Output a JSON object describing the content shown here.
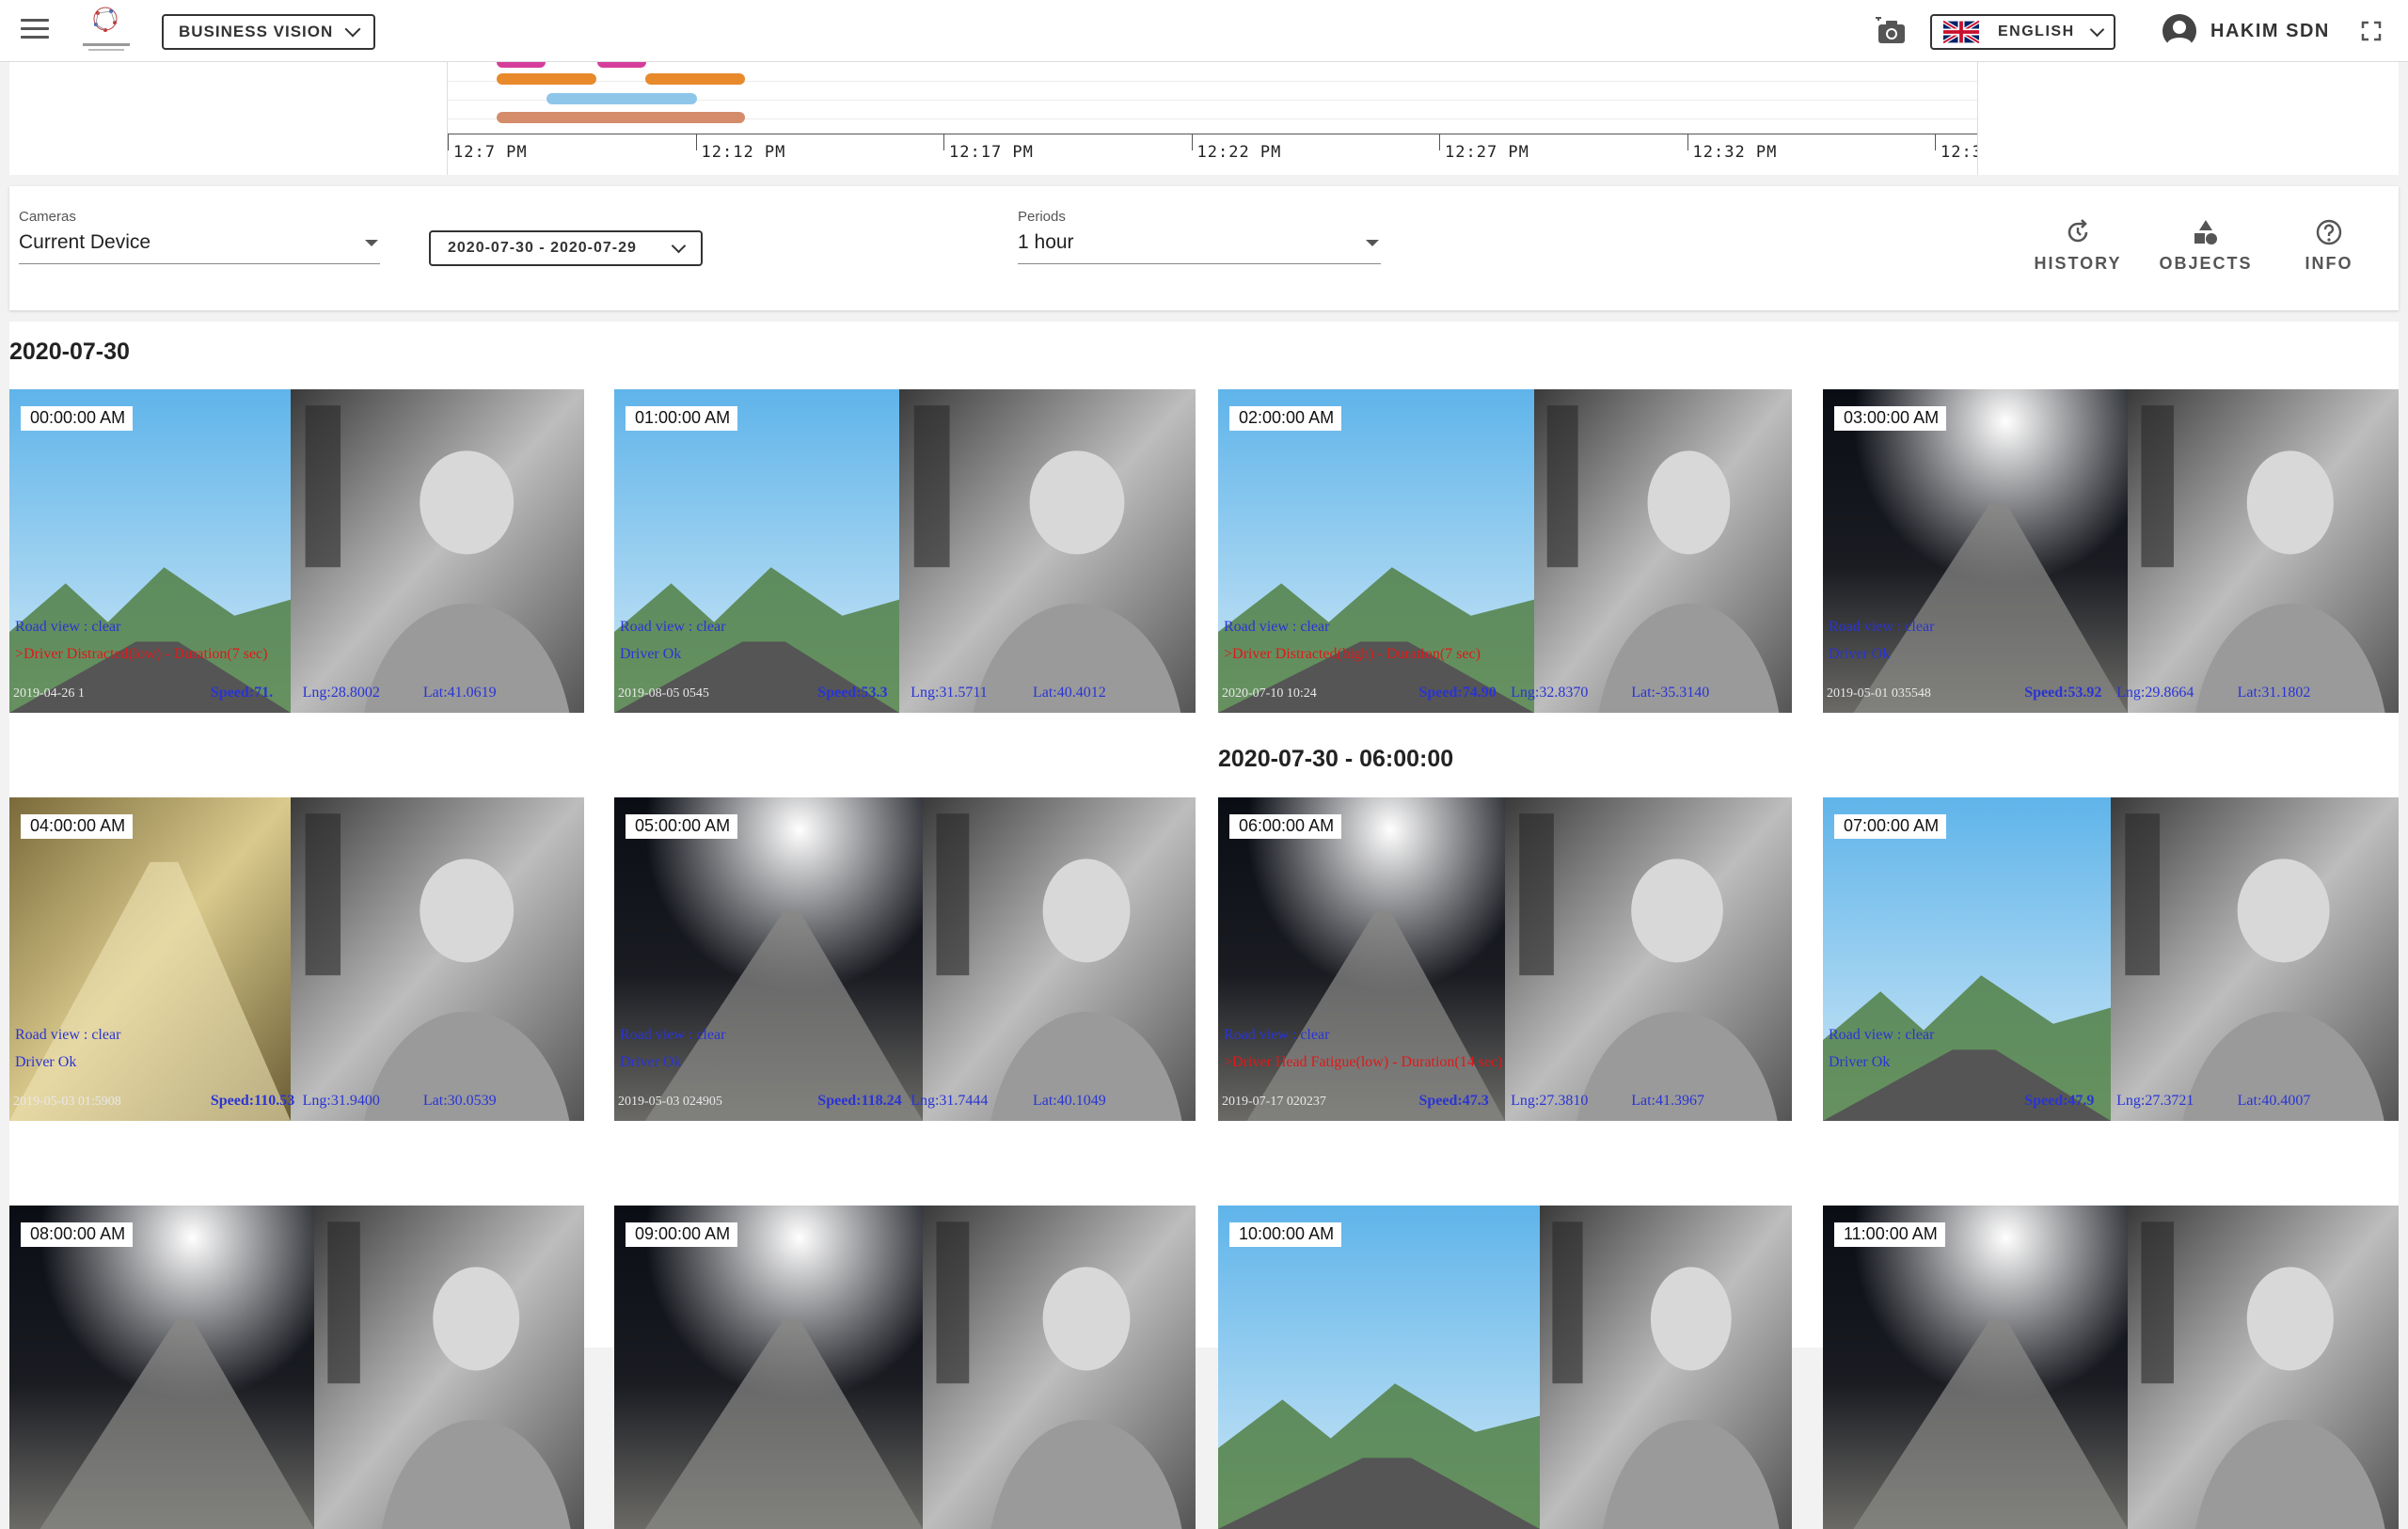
{
  "header": {
    "vision_label": "BUSINESS VISION",
    "language_label": "ENGLISH",
    "user_name": "HAKIM SDN"
  },
  "timeline": {
    "labels": [
      "12:7 PM",
      "12:12 PM",
      "12:17 PM",
      "12:22 PM",
      "12:27 PM",
      "12:32 PM",
      "12:3"
    ]
  },
  "filters": {
    "cameras_label": "Cameras",
    "cameras_value": "Current Device",
    "date_range": "2020-07-30 - 2020-07-29",
    "periods_label": "Periods",
    "periods_value": "1 hour",
    "actions": {
      "history": "HISTORY",
      "objects": "OBJECTS",
      "info": "INFO"
    }
  },
  "groups": [
    {
      "title": "2020-07-30"
    },
    {
      "title": "2020-07-30 - 06:00:00"
    }
  ],
  "thumbnails": [
    {
      "time": "00:00:00 AM",
      "road": "Road view : clear",
      "status": ">Driver Distracted(low) -  Duration(7 sec)",
      "status_color": "red",
      "date": "2019-04-26 1",
      "speed": "Speed:71.",
      "lng": "Lng:28.8002",
      "lat": "Lat:41.0619"
    },
    {
      "time": "01:00:00 AM",
      "road": "Road view : clear",
      "status": "Driver Ok",
      "status_color": "blue",
      "date": "2019-08-05 0545",
      "speed": "Speed:53.3",
      "lng": "Lng:31.5711",
      "lat": "Lat:40.4012"
    },
    {
      "time": "02:00:00 AM",
      "road": "Road view : clear",
      "status": ">Driver Distracted(high) -  Duration(7 sec)",
      "status_color": "red",
      "date": "2020-07-10 10:24",
      "speed": "Speed:74.90",
      "lng": "Lng:32.8370",
      "lat": "Lat:-35.3140"
    },
    {
      "time": "03:00:00 AM",
      "road": "Road view : clear",
      "status": "Driver Ok",
      "status_color": "blue",
      "date": "2019-05-01 035548",
      "speed": "Speed:53.92",
      "lng": "Lng:29.8664",
      "lat": "Lat:31.1802"
    },
    {
      "time": "04:00:00 AM",
      "road": "Road view : clear",
      "status": "Driver Ok",
      "status_color": "blue",
      "date": "2019-05-03 01:5908",
      "speed": "Speed:110.53",
      "lng": "Lng:31.9400",
      "lat": "Lat:30.0539"
    },
    {
      "time": "05:00:00 AM",
      "road": "Road view : clear",
      "status": "Driver Ok",
      "status_color": "blue",
      "date": "2019-05-03 024905",
      "speed": "Speed:118.24",
      "lng": "Lng:31.7444",
      "lat": "Lat:40.1049"
    },
    {
      "time": "06:00:00 AM",
      "road": "Road view : clear",
      "status": ">Driver Head Fatigue(low) -  Duration(14 sec)",
      "status_color": "red",
      "date": "2019-07-17 020237",
      "speed": "Speed:47.3",
      "lng": "Lng:27.3810",
      "lat": "Lat:41.3967"
    },
    {
      "time": "07:00:00 AM",
      "road": "Road view : clear",
      "status": "Driver Ok",
      "status_color": "blue",
      "date": "",
      "speed": "Speed:47.9",
      "lng": "Lng:27.3721",
      "lat": "Lat:40.4007"
    },
    {
      "time": "08:00:00 AM"
    },
    {
      "time": "09:00:00 AM"
    },
    {
      "time": "10:00:00 AM"
    },
    {
      "time": "11:00:00 AM"
    }
  ],
  "colors": {
    "bar_pink": "#d63d9a",
    "bar_orange": "#e8892b",
    "bar_blue": "#8ec6ea",
    "bar_brown": "#d48c6a",
    "overlay_blue": "#2a34d4",
    "overlay_red": "#e01818"
  }
}
